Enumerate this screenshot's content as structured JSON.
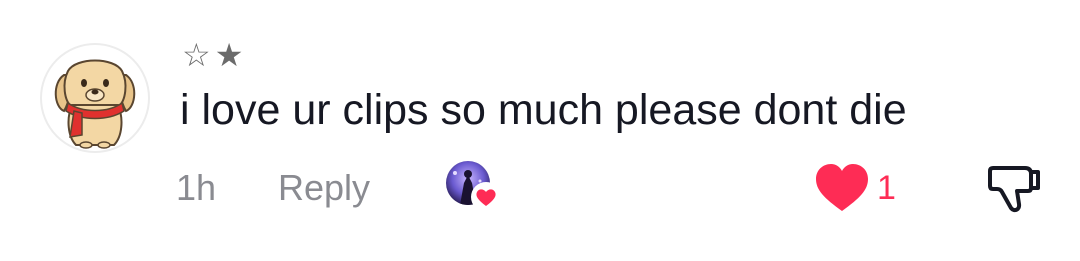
{
  "comment": {
    "username": "☆★",
    "text": "i love ur clips so much please dont die",
    "timestamp": "1h",
    "reply_label": "Reply",
    "like_count": "1",
    "creator_liked": true
  },
  "icons": {
    "avatar": "dog-avatar-icon",
    "creator_avatar": "creator-avatar-icon",
    "creator_heart": "heart-badge-icon",
    "like": "heart-icon",
    "dislike": "thumbs-down-icon"
  },
  "colors": {
    "text": "#161823",
    "muted": "#8a8b91",
    "like": "#fe2c55"
  }
}
